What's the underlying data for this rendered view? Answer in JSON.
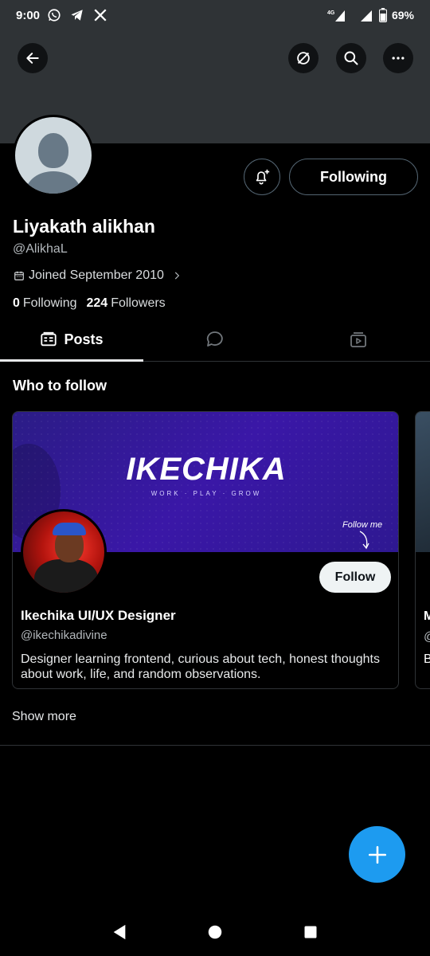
{
  "status_bar": {
    "time": "9:00",
    "network": "4G",
    "battery": "69%",
    "icons": [
      "whatsapp-icon",
      "telegram-icon",
      "x-icon"
    ]
  },
  "header": {
    "buttons": [
      "back-icon",
      "grok-icon",
      "search-icon",
      "more-icon"
    ]
  },
  "profile": {
    "display_name": "Liyakath alikhan",
    "handle": "@AlikhaL",
    "joined": "Joined September 2010",
    "following_count": "0",
    "following_label": "Following",
    "followers_count": "224",
    "followers_label": "Followers",
    "follow_button_label": "Following"
  },
  "tabs": [
    {
      "label": "Posts",
      "icon": "posts-icon",
      "active": true
    },
    {
      "label": "",
      "icon": "replies-icon",
      "active": false
    },
    {
      "label": "",
      "icon": "media-icon",
      "active": false
    }
  ],
  "who_to_follow": {
    "title": "Who to follow",
    "cards": [
      {
        "banner_text": "IKECHIKA",
        "banner_tagline": "WORK · PLAY · GROW",
        "banner_note": "Follow me",
        "name": "Ikechika UI/UX Designer",
        "handle": "@ikechikadivine",
        "bio": "Designer learning frontend, curious about tech, honest thoughts about work, life, and random observations.",
        "follow_label": "Follow"
      }
    ],
    "peek_card": {
      "name_initial": "M",
      "handle_initial": "@",
      "bio_initial": "B"
    },
    "show_more": "Show more"
  },
  "fab": {
    "icon": "plus-icon"
  },
  "colors": {
    "accent": "#1d9bf0",
    "background": "#000000",
    "banner": "#2f3336"
  }
}
